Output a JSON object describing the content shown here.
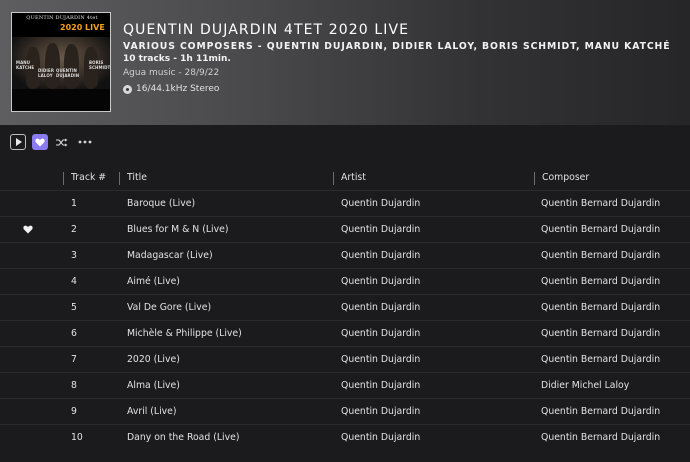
{
  "album": {
    "title": "QUENTIN DUJARDIN 4TET 2020 LIVE",
    "artists": "VARIOUS COMPOSERS - QUENTIN DUJARDIN, DIDIER LALOY, BORIS SCHMIDT, MANU KATCHÉ",
    "tracks_summary": "10 tracks - 1h 11min.",
    "label_date": "Agua music - 28/9/22",
    "quality": "16/44.1kHz Stereo",
    "quality_icon": "cd-icon"
  },
  "cover": {
    "title": "QUENTIN DUJARDIN 4tet",
    "year": "2020 LIVE",
    "names": [
      "MANU KATCHE",
      "DIDIER LALOY",
      "QUENTIN DUJARDIN",
      "BORIS SCHMIDT"
    ],
    "accent": "#f0a020"
  },
  "toolbar": {
    "play_icon": "play-icon",
    "favorite_icon": "heart-icon",
    "shuffle_icon": "shuffle-icon",
    "more_icon": "more-icon",
    "favorite_color": "#8a7cf0"
  },
  "table": {
    "headers": {
      "track": "Track #",
      "title": "Title",
      "artist": "Artist",
      "composer": "Composer"
    },
    "rows": [
      {
        "track": "1",
        "title": "Baroque (Live)",
        "artist": "Quentin Dujardin",
        "composer": "Quentin Bernard Dujardin",
        "favorite": false
      },
      {
        "track": "2",
        "title": "Blues for M & N (Live)",
        "artist": "Quentin Dujardin",
        "composer": "Quentin Bernard Dujardin",
        "favorite": true
      },
      {
        "track": "3",
        "title": "Madagascar (Live)",
        "artist": "Quentin Dujardin",
        "composer": "Quentin Bernard Dujardin",
        "favorite": false
      },
      {
        "track": "4",
        "title": "Aimé (Live)",
        "artist": "Quentin Dujardin",
        "composer": "Quentin Bernard Dujardin",
        "favorite": false
      },
      {
        "track": "5",
        "title": "Val De Gore (Live)",
        "artist": "Quentin Dujardin",
        "composer": "Quentin Bernard Dujardin",
        "favorite": false
      },
      {
        "track": "6",
        "title": "Michèle & Philippe (Live)",
        "artist": "Quentin Dujardin",
        "composer": "Quentin Bernard Dujardin",
        "favorite": false
      },
      {
        "track": "7",
        "title": "2020 (Live)",
        "artist": "Quentin Dujardin",
        "composer": "Quentin Bernard Dujardin",
        "favorite": false
      },
      {
        "track": "8",
        "title": "Alma (Live)",
        "artist": "Quentin Dujardin",
        "composer": "Didier Michel Laloy",
        "favorite": false
      },
      {
        "track": "9",
        "title": "Avril (Live)",
        "artist": "Quentin Dujardin",
        "composer": "Quentin Bernard Dujardin",
        "favorite": false
      },
      {
        "track": "10",
        "title": "Dany on the Road (Live)",
        "artist": "Quentin Dujardin",
        "composer": "Quentin Bernard Dujardin",
        "favorite": false
      }
    ]
  }
}
